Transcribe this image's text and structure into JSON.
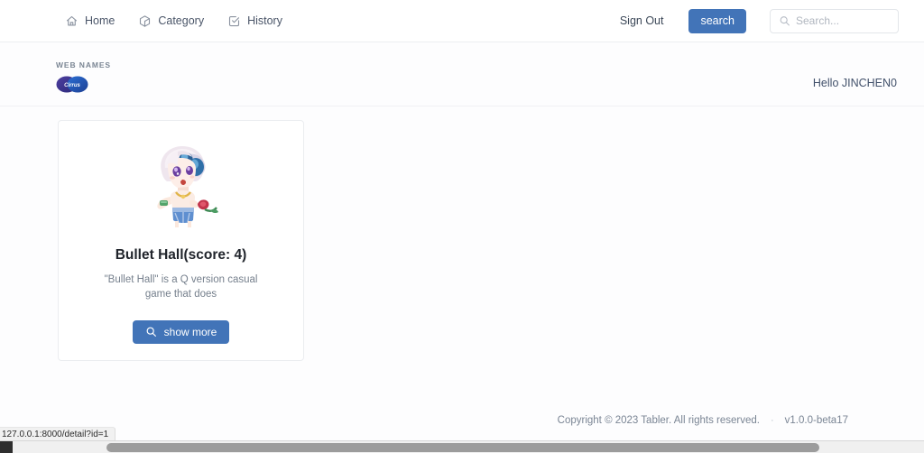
{
  "colors": {
    "accent": "#4274b8",
    "page_bg": "#fdfdfe",
    "card_border": "#ebedf0",
    "text_muted": "#76808d"
  },
  "topbar": {
    "nav_items": [
      {
        "label": "Home",
        "icon": "home-icon"
      },
      {
        "label": "Category",
        "icon": "box-icon"
      },
      {
        "label": "History",
        "icon": "checkbox-check-icon"
      }
    ],
    "sign_out_label": "Sign Out",
    "search_button_label": "search",
    "search": {
      "icon": "search-icon",
      "value": "",
      "placeholder": "Search..."
    }
  },
  "brandbar": {
    "kicker": "WEB NAMES",
    "logo_label": "Cirrus",
    "greeting": "Hello JINCHEN0"
  },
  "cards": [
    {
      "title": "Bullet Hall(score: 4)",
      "description": "\"Bullet Hall\" is a Q version casual game that does",
      "button_label": "show more",
      "button_icon": "search-icon",
      "thumbnail": "chibi-character-artwork"
    }
  ],
  "footer": {
    "copyright": "Copyright © 2023 Tabler. All rights reserved.",
    "separator": "·",
    "version": "v1.0.0-beta17"
  },
  "browser": {
    "status_url": "127.0.0.1:8000/detail?id=1"
  }
}
